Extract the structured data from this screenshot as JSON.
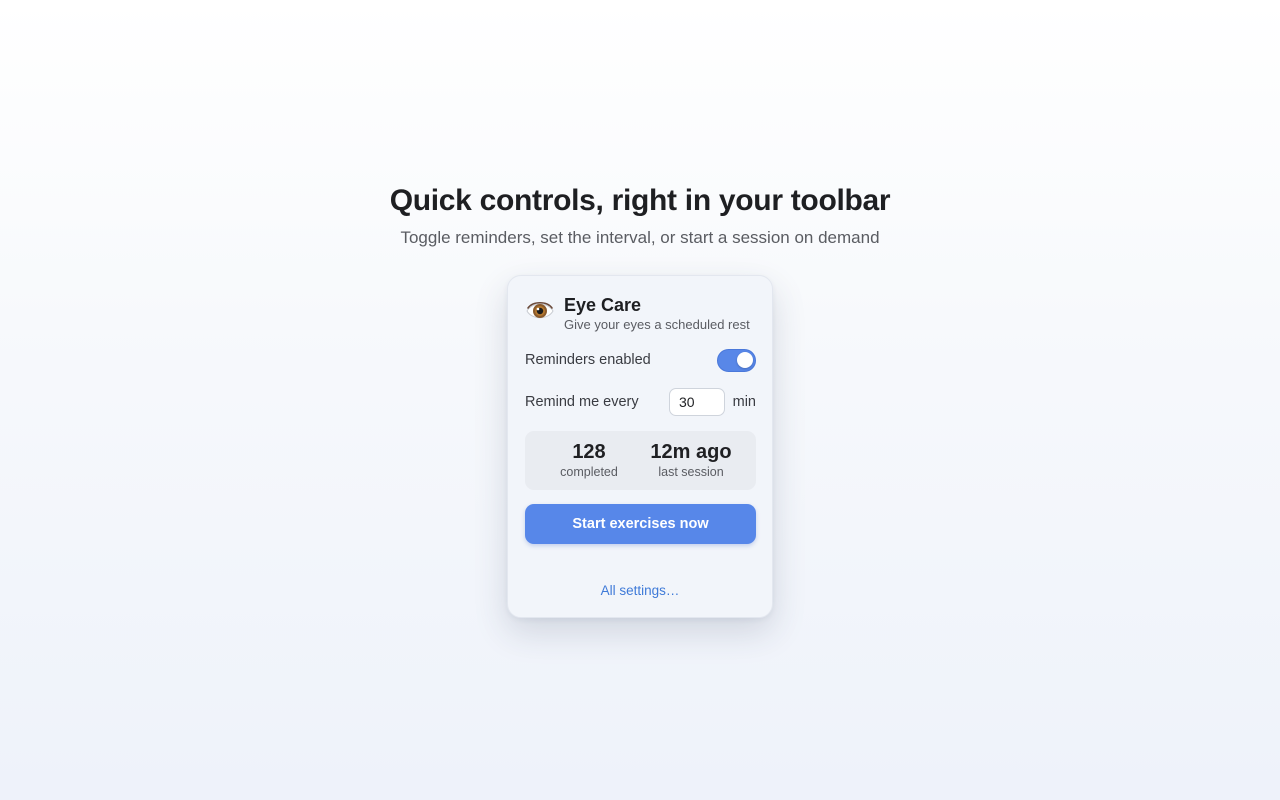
{
  "hero": {
    "title": "Quick controls, right in your toolbar",
    "subtitle": "Toggle reminders, set the interval, or start a session on demand"
  },
  "popup": {
    "icon": "eye-icon",
    "app_name": "Eye Care",
    "tagline": "Give your eyes a scheduled rest",
    "reminders": {
      "label": "Reminders enabled",
      "enabled": true
    },
    "interval": {
      "label": "Remind me every",
      "value": "30",
      "unit": "min"
    },
    "stats": [
      {
        "value": "128",
        "label": "completed"
      },
      {
        "value": "12m ago",
        "label": "last session"
      }
    ],
    "start_button_label": "Start exercises now",
    "settings_link_label": "All settings…"
  },
  "colors": {
    "accent": "#5787e9",
    "link": "#3f7ad8",
    "popup_background": "#f2f5fa",
    "stats_background": "#e9ecf1"
  }
}
